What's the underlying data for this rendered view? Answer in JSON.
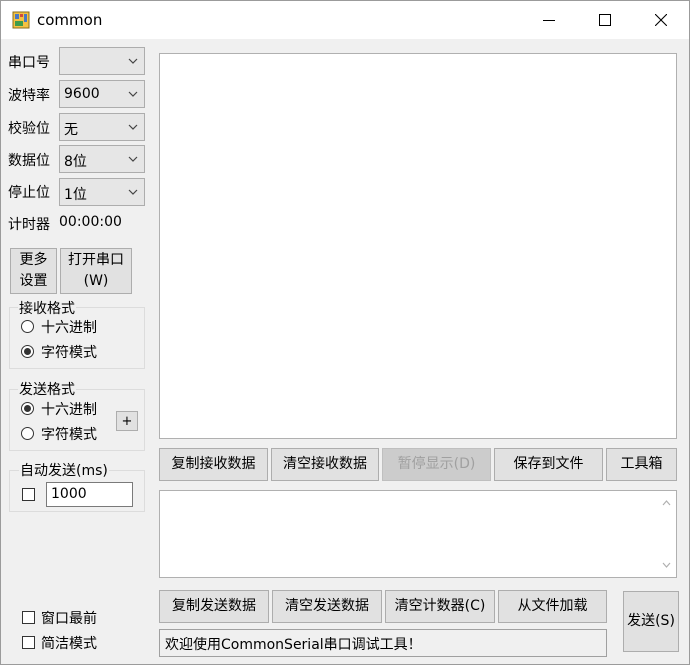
{
  "window": {
    "title": "common"
  },
  "settings": {
    "port_label": "串口号",
    "port_value": "",
    "baud_label": "波特率",
    "baud_value": "9600",
    "parity_label": "校验位",
    "parity_value": "无",
    "databits_label": "数据位",
    "databits_value": "8位",
    "stopbits_label": "停止位",
    "stopbits_value": "1位",
    "timer_label": "计时器",
    "timer_value": "00:00:00"
  },
  "buttons": {
    "more_line1": "更多",
    "more_line2": "设置",
    "open_line1": "打开串口",
    "open_line2": "(W)",
    "plus": "+",
    "copy_recv": "复制接收数据",
    "clear_recv": "清空接收数据",
    "pause_display": "暂停显示(D)",
    "save_file": "保存到文件",
    "toolbox": "工具箱",
    "copy_send": "复制发送数据",
    "clear_send": "清空发送数据",
    "clear_counter": "清空计数器(C)",
    "load_file": "从文件加载",
    "send": "发送(S)"
  },
  "receive_format": {
    "title": "接收格式",
    "hex": "十六进制",
    "char": "字符模式",
    "selected": "char"
  },
  "send_format": {
    "title": "发送格式",
    "hex": "十六进制",
    "char": "字符模式",
    "selected": "hex"
  },
  "auto_send": {
    "title": "自动发送(ms)",
    "checked": false,
    "interval": "1000"
  },
  "options": {
    "topmost": "窗口最前",
    "simple_mode": "简洁模式"
  },
  "status": {
    "message": "欢迎使用CommonSerial串口调试工具！"
  },
  "colors": {
    "title_bg": "#ffffff",
    "window_bg": "#f0f0f0",
    "button_bg": "#e1e1e1",
    "disabled_text": "#a0a0a0"
  }
}
